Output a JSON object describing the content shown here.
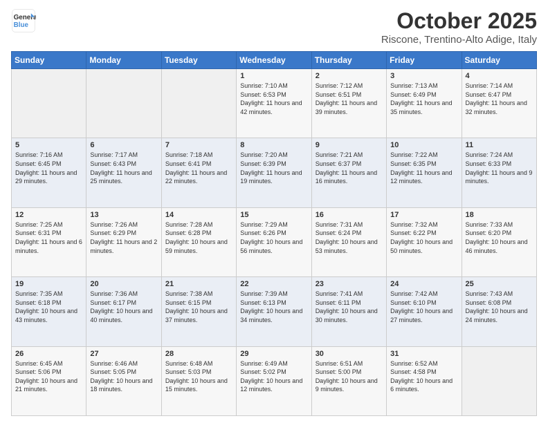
{
  "header": {
    "logo_line1": "General",
    "logo_line2": "Blue",
    "title": "October 2025",
    "subtitle": "Riscone, Trentino-Alto Adige, Italy"
  },
  "days_of_week": [
    "Sunday",
    "Monday",
    "Tuesday",
    "Wednesday",
    "Thursday",
    "Friday",
    "Saturday"
  ],
  "weeks": [
    [
      {
        "day": "",
        "sunrise": "",
        "sunset": "",
        "daylight": ""
      },
      {
        "day": "",
        "sunrise": "",
        "sunset": "",
        "daylight": ""
      },
      {
        "day": "",
        "sunrise": "",
        "sunset": "",
        "daylight": ""
      },
      {
        "day": "1",
        "sunrise": "Sunrise: 7:10 AM",
        "sunset": "Sunset: 6:53 PM",
        "daylight": "Daylight: 11 hours and 42 minutes."
      },
      {
        "day": "2",
        "sunrise": "Sunrise: 7:12 AM",
        "sunset": "Sunset: 6:51 PM",
        "daylight": "Daylight: 11 hours and 39 minutes."
      },
      {
        "day": "3",
        "sunrise": "Sunrise: 7:13 AM",
        "sunset": "Sunset: 6:49 PM",
        "daylight": "Daylight: 11 hours and 35 minutes."
      },
      {
        "day": "4",
        "sunrise": "Sunrise: 7:14 AM",
        "sunset": "Sunset: 6:47 PM",
        "daylight": "Daylight: 11 hours and 32 minutes."
      }
    ],
    [
      {
        "day": "5",
        "sunrise": "Sunrise: 7:16 AM",
        "sunset": "Sunset: 6:45 PM",
        "daylight": "Daylight: 11 hours and 29 minutes."
      },
      {
        "day": "6",
        "sunrise": "Sunrise: 7:17 AM",
        "sunset": "Sunset: 6:43 PM",
        "daylight": "Daylight: 11 hours and 25 minutes."
      },
      {
        "day": "7",
        "sunrise": "Sunrise: 7:18 AM",
        "sunset": "Sunset: 6:41 PM",
        "daylight": "Daylight: 11 hours and 22 minutes."
      },
      {
        "day": "8",
        "sunrise": "Sunrise: 7:20 AM",
        "sunset": "Sunset: 6:39 PM",
        "daylight": "Daylight: 11 hours and 19 minutes."
      },
      {
        "day": "9",
        "sunrise": "Sunrise: 7:21 AM",
        "sunset": "Sunset: 6:37 PM",
        "daylight": "Daylight: 11 hours and 16 minutes."
      },
      {
        "day": "10",
        "sunrise": "Sunrise: 7:22 AM",
        "sunset": "Sunset: 6:35 PM",
        "daylight": "Daylight: 11 hours and 12 minutes."
      },
      {
        "day": "11",
        "sunrise": "Sunrise: 7:24 AM",
        "sunset": "Sunset: 6:33 PM",
        "daylight": "Daylight: 11 hours and 9 minutes."
      }
    ],
    [
      {
        "day": "12",
        "sunrise": "Sunrise: 7:25 AM",
        "sunset": "Sunset: 6:31 PM",
        "daylight": "Daylight: 11 hours and 6 minutes."
      },
      {
        "day": "13",
        "sunrise": "Sunrise: 7:26 AM",
        "sunset": "Sunset: 6:29 PM",
        "daylight": "Daylight: 11 hours and 2 minutes."
      },
      {
        "day": "14",
        "sunrise": "Sunrise: 7:28 AM",
        "sunset": "Sunset: 6:28 PM",
        "daylight": "Daylight: 10 hours and 59 minutes."
      },
      {
        "day": "15",
        "sunrise": "Sunrise: 7:29 AM",
        "sunset": "Sunset: 6:26 PM",
        "daylight": "Daylight: 10 hours and 56 minutes."
      },
      {
        "day": "16",
        "sunrise": "Sunrise: 7:31 AM",
        "sunset": "Sunset: 6:24 PM",
        "daylight": "Daylight: 10 hours and 53 minutes."
      },
      {
        "day": "17",
        "sunrise": "Sunrise: 7:32 AM",
        "sunset": "Sunset: 6:22 PM",
        "daylight": "Daylight: 10 hours and 50 minutes."
      },
      {
        "day": "18",
        "sunrise": "Sunrise: 7:33 AM",
        "sunset": "Sunset: 6:20 PM",
        "daylight": "Daylight: 10 hours and 46 minutes."
      }
    ],
    [
      {
        "day": "19",
        "sunrise": "Sunrise: 7:35 AM",
        "sunset": "Sunset: 6:18 PM",
        "daylight": "Daylight: 10 hours and 43 minutes."
      },
      {
        "day": "20",
        "sunrise": "Sunrise: 7:36 AM",
        "sunset": "Sunset: 6:17 PM",
        "daylight": "Daylight: 10 hours and 40 minutes."
      },
      {
        "day": "21",
        "sunrise": "Sunrise: 7:38 AM",
        "sunset": "Sunset: 6:15 PM",
        "daylight": "Daylight: 10 hours and 37 minutes."
      },
      {
        "day": "22",
        "sunrise": "Sunrise: 7:39 AM",
        "sunset": "Sunset: 6:13 PM",
        "daylight": "Daylight: 10 hours and 34 minutes."
      },
      {
        "day": "23",
        "sunrise": "Sunrise: 7:41 AM",
        "sunset": "Sunset: 6:11 PM",
        "daylight": "Daylight: 10 hours and 30 minutes."
      },
      {
        "day": "24",
        "sunrise": "Sunrise: 7:42 AM",
        "sunset": "Sunset: 6:10 PM",
        "daylight": "Daylight: 10 hours and 27 minutes."
      },
      {
        "day": "25",
        "sunrise": "Sunrise: 7:43 AM",
        "sunset": "Sunset: 6:08 PM",
        "daylight": "Daylight: 10 hours and 24 minutes."
      }
    ],
    [
      {
        "day": "26",
        "sunrise": "Sunrise: 6:45 AM",
        "sunset": "Sunset: 5:06 PM",
        "daylight": "Daylight: 10 hours and 21 minutes."
      },
      {
        "day": "27",
        "sunrise": "Sunrise: 6:46 AM",
        "sunset": "Sunset: 5:05 PM",
        "daylight": "Daylight: 10 hours and 18 minutes."
      },
      {
        "day": "28",
        "sunrise": "Sunrise: 6:48 AM",
        "sunset": "Sunset: 5:03 PM",
        "daylight": "Daylight: 10 hours and 15 minutes."
      },
      {
        "day": "29",
        "sunrise": "Sunrise: 6:49 AM",
        "sunset": "Sunset: 5:02 PM",
        "daylight": "Daylight: 10 hours and 12 minutes."
      },
      {
        "day": "30",
        "sunrise": "Sunrise: 6:51 AM",
        "sunset": "Sunset: 5:00 PM",
        "daylight": "Daylight: 10 hours and 9 minutes."
      },
      {
        "day": "31",
        "sunrise": "Sunrise: 6:52 AM",
        "sunset": "Sunset: 4:58 PM",
        "daylight": "Daylight: 10 hours and 6 minutes."
      },
      {
        "day": "",
        "sunrise": "",
        "sunset": "",
        "daylight": ""
      }
    ]
  ]
}
